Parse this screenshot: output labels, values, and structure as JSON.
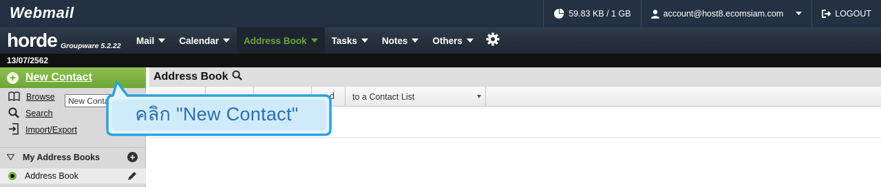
{
  "top": {
    "brand": "Webmail",
    "quota": "59.83 KB / 1 GB",
    "account": "account@host8.ecomsiam.com",
    "logout": "LOGOUT"
  },
  "horde": {
    "logo": "horde",
    "version": "Groupware 5.2.22"
  },
  "nav": {
    "items": [
      {
        "label": "Mail"
      },
      {
        "label": "Calendar"
      },
      {
        "label": "Address Book",
        "active": true
      },
      {
        "label": "Tasks"
      },
      {
        "label": "Notes"
      },
      {
        "label": "Others"
      }
    ],
    "settings_icon": "gear-icon"
  },
  "date": "13/07/2562",
  "sidebar": {
    "new_contact": "New Contact",
    "links": [
      {
        "label": "Browse",
        "icon": "book-icon"
      },
      {
        "label": "Search",
        "icon": "search-icon"
      },
      {
        "label": "Import/Export",
        "icon": "import-export-icon"
      }
    ],
    "section_title": "My Address Books",
    "books": [
      {
        "label": "Address Book"
      }
    ]
  },
  "main": {
    "title": "Address Book",
    "toolbar_partial": "d",
    "add_to_list": "to a Contact List"
  },
  "tooltip": "New Contact",
  "callout": "คลิก \"New Contact\"",
  "colors": {
    "top_bar": "#233142",
    "accent_green": "#6ea633",
    "callout_border": "#29a3df",
    "callout_fill": "#e4f3fd",
    "callout_text": "#2a6fb4"
  }
}
